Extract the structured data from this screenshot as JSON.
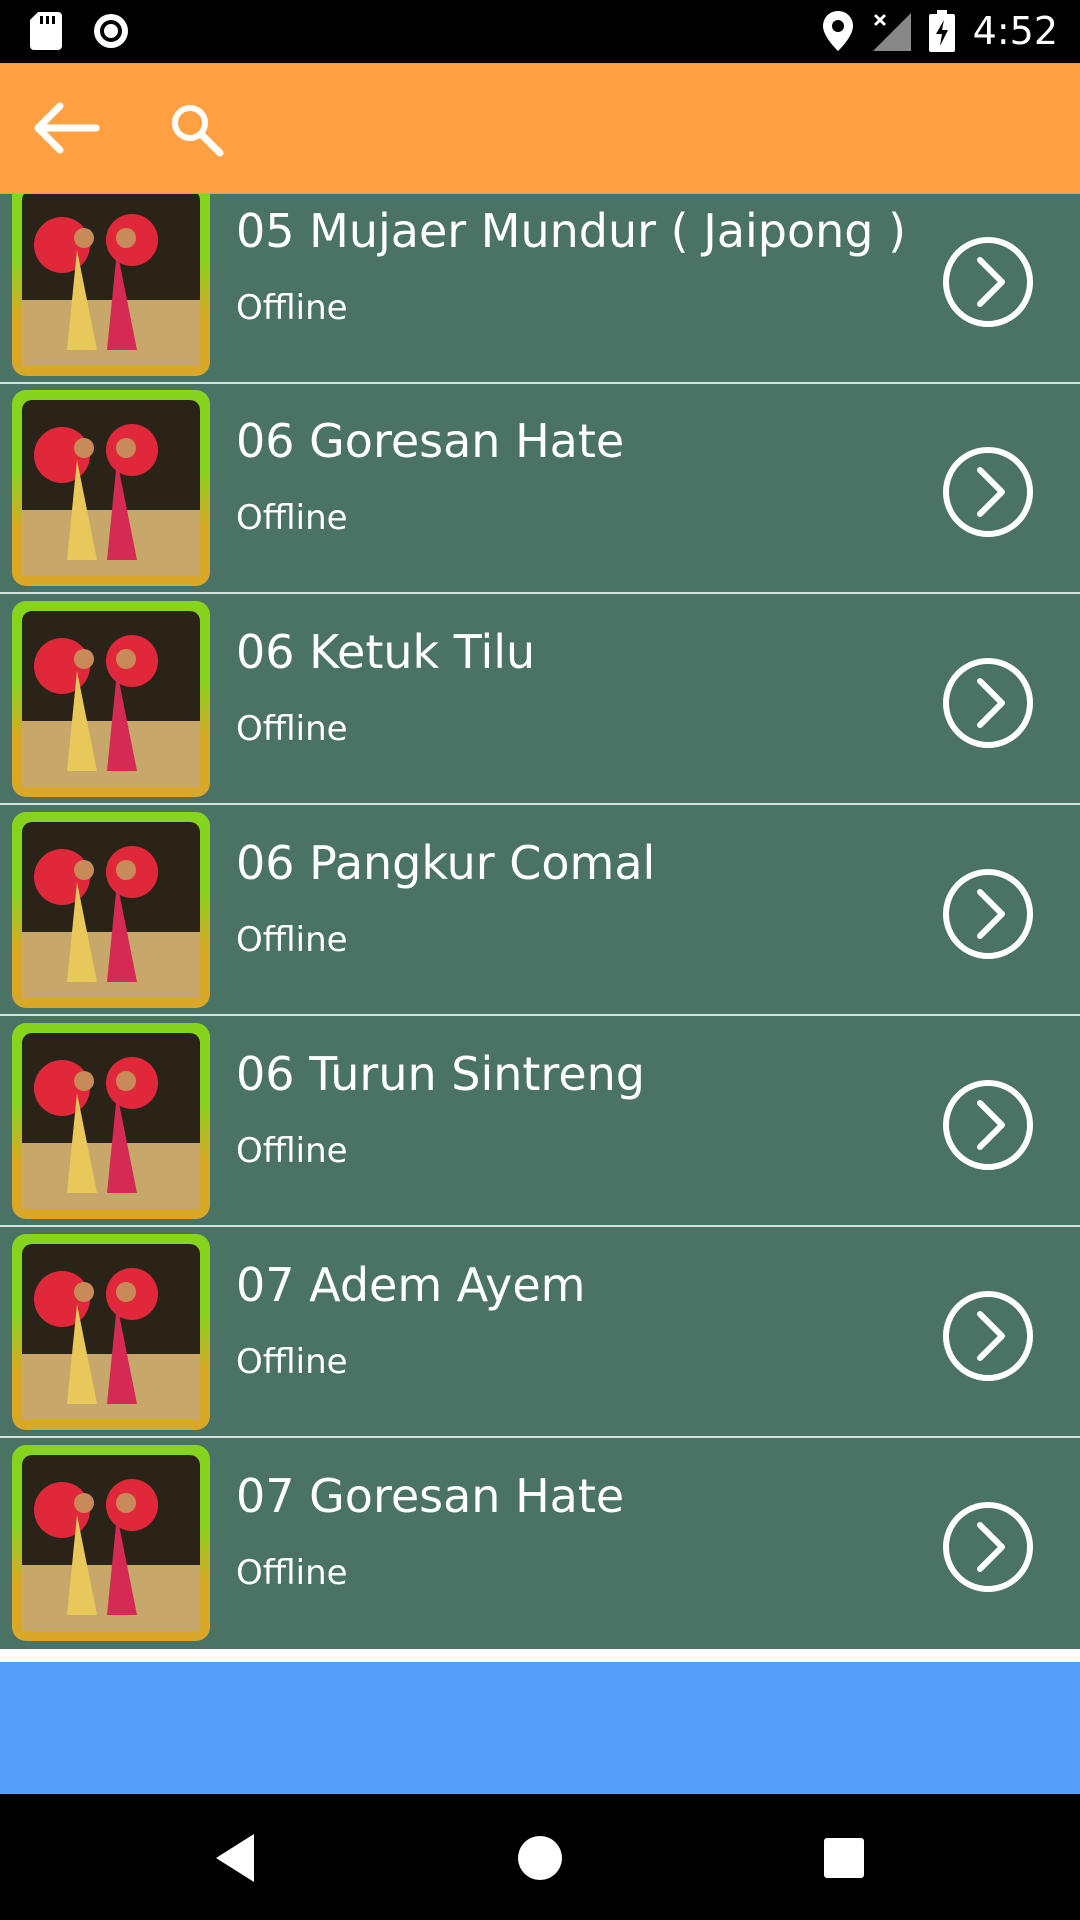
{
  "status_bar": {
    "time": "4:52"
  },
  "list": {
    "items": [
      {
        "title": "05 Mujaer Mundur ( Jaipong )",
        "status": "Offline"
      },
      {
        "title": "06 Goresan Hate",
        "status": "Offline"
      },
      {
        "title": "06 Ketuk Tilu",
        "status": "Offline"
      },
      {
        "title": "06 Pangkur Comal",
        "status": "Offline"
      },
      {
        "title": "06 Turun Sintreng",
        "status": "Offline"
      },
      {
        "title": "07 Adem Ayem",
        "status": "Offline"
      },
      {
        "title": "07 Goresan Hate",
        "status": "Offline"
      }
    ]
  },
  "colors": {
    "app_bar": "#FFA142",
    "list_bg": "#4B7365",
    "ad_area": "#579EF9"
  },
  "icons": {
    "back": "arrow-left-icon",
    "search": "search-icon",
    "item_action": "chevron-right-circle-icon"
  }
}
